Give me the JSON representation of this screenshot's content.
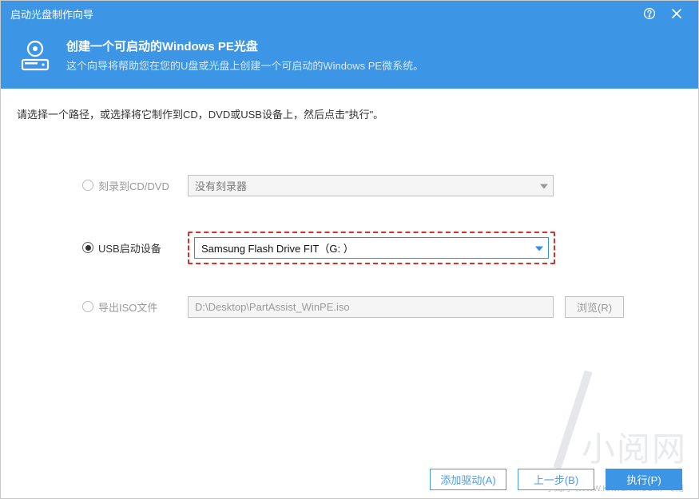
{
  "titlebar": {
    "title": "启动光盘制作向导"
  },
  "banner": {
    "heading": "创建一个可启动的Windows PE光盘",
    "sub": "这个向导将帮助您在您的U盘或光盘上创建一个可启动的Windows PE微系统。"
  },
  "instruction": "请选择一个路径，或选择将它制作到CD，DVD或USB设备上，然后点击\"执行\"。",
  "options": {
    "cd": {
      "label": "刻录到CD/DVD",
      "value": "没有刻录器"
    },
    "usb": {
      "label": "USB启动设备",
      "value": "Samsung Flash Drive FIT（G: ）"
    },
    "iso": {
      "label": "导出ISO文件",
      "value": "D:\\Desktop\\PartAssist_WinPE.iso",
      "browse": "浏览(R)"
    }
  },
  "footer": {
    "add_driver": "添加驱动(A)",
    "prev": "上一步(B)",
    "run": "执行(P)"
  },
  "watermark": {
    "main": "小阅网",
    "sub": "小阅网（WWW.KXWENW.COM）专用"
  }
}
